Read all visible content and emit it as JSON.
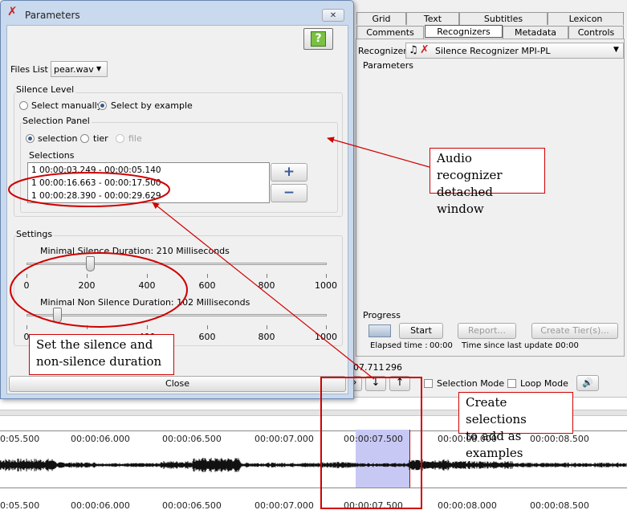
{
  "dialog": {
    "title": "Parameters",
    "close_glyph": "✕",
    "help_glyph": "?",
    "files_list_label": "Files List :",
    "files_list_value": "pear.wav",
    "silence_level_title": "Silence Level",
    "select_manually": "Select manually",
    "select_by_example": "Select by example",
    "selection_panel_title": "Selection Panel",
    "radio_selection": "selection",
    "radio_tier": "tier",
    "radio_file": "file",
    "selections_label": "Selections",
    "selections": [
      "1 00:00:03.249 - 00:00:05.140",
      "1 00:00:16.663 - 00:00:17.500",
      "1 00:00:28.390 - 00:00:29.629"
    ],
    "add_glyph": "+",
    "remove_glyph": "−",
    "settings_title": "Settings",
    "min_silence_label": "Minimal Silence Duration: 210 Milliseconds",
    "min_silence_value": 210,
    "min_nonsilence_label": "Minimal Non Silence Duration: 102 Milliseconds",
    "min_nonsilence_value": 102,
    "slider_max": 1000,
    "ticks": [
      "0",
      "200",
      "400",
      "600",
      "800",
      "1000"
    ],
    "ticks_partial": [
      "0",
      "400",
      "600",
      "800",
      "1000"
    ],
    "close_button": "Close"
  },
  "tabs_row1": [
    "Grid",
    "Text",
    "Subtitles",
    "Lexicon"
  ],
  "tabs_row2": [
    "Comments",
    "Recognizers",
    "Metadata",
    "Controls"
  ],
  "recognizer": {
    "label": "Recognizer:",
    "value": "Silence Recognizer MPI-PL",
    "parameters_label": "Parameters",
    "progress_label": "Progress",
    "start_button": "Start",
    "report_button": "Report...",
    "create_tiers_button": "Create Tier(s)...",
    "elapsed_label": "Elapsed time :",
    "elapsed_value": "00:00",
    "since_update_label": "Time since last update :",
    "since_update_value": "00:00"
  },
  "player": {
    "time_readout": "07.711",
    "time_readout2": "296",
    "selection_mode": "Selection Mode",
    "loop_mode": "Loop Mode",
    "down_glyph": "↓",
    "up_glyph": "↑",
    "right_glyph": "›",
    "speaker_glyph": "🔊"
  },
  "timeline": {
    "top_labels": [
      "0:05.500",
      "00:00:06.000",
      "00:00:06.500",
      "00:00:07.000",
      "00:00:07.500",
      "00:00:08.000",
      "00:00:08.500"
    ],
    "bottom_labels": [
      "0:05.500",
      "00:00:06.000",
      "00:00:06.500",
      "00:00:07.000",
      "00:00:07.500",
      "00:00:08.000",
      "00:00:08.500"
    ]
  },
  "annotations": {
    "audio_recognizer": [
      "Audio recognizer",
      "detached window"
    ],
    "silence_duration": [
      "Set the silence and",
      "non-silence duration"
    ],
    "create_selections": [
      "Create selections",
      "to add as examples"
    ]
  },
  "colors": {
    "accent_red": "#d00000",
    "selection_fill": "#c8c8f5",
    "crosshair": "#c00000"
  }
}
